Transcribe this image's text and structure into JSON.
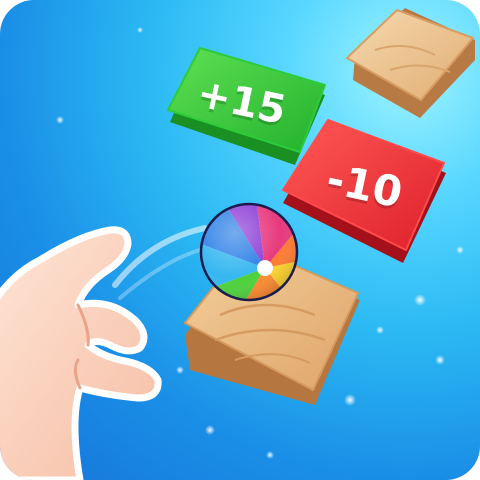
{
  "scene": {
    "title": "",
    "tiles": {
      "green": {
        "label": "+15",
        "color": "#2fbf39"
      },
      "red": {
        "label": "-10",
        "color": "#e8262f"
      },
      "wood_top": {
        "label": "",
        "color": "#e3b17a"
      },
      "wood_main": {
        "label": "",
        "color": "#e3b17a"
      }
    },
    "ball": {
      "icon": "beach-ball-icon"
    },
    "hand": {
      "icon": "pointing-hand-icon"
    },
    "colors": {
      "background": "#1e9ff0",
      "background_highlight": "#9ff4ff",
      "wood": "#e3b17a",
      "skin": "#ffd6c2"
    }
  }
}
